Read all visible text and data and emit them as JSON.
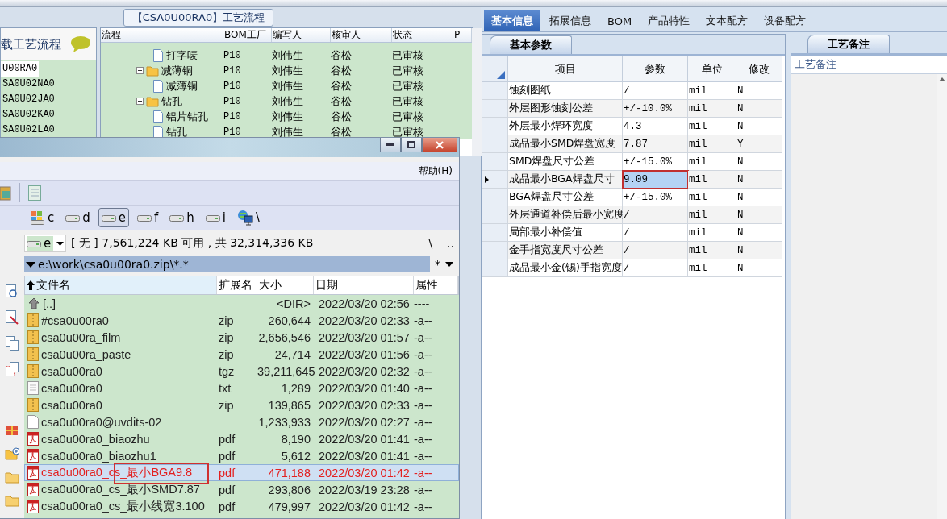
{
  "process_window": {
    "title": "【CSA0U00RA0】工艺流程",
    "side_panel": {
      "heading": "载工艺流程",
      "items": [
        {
          "label": "U00RA0",
          "selected": true
        },
        {
          "label": "SA0U02NA0",
          "selected": false
        },
        {
          "label": "SA0U02JA0",
          "selected": false
        },
        {
          "label": "SA0U02KA0",
          "selected": false
        },
        {
          "label": "SA0U02LA0",
          "selected": false
        }
      ]
    },
    "tree_table": {
      "columns": [
        "流程",
        "BOM工厂",
        "编写人",
        "核审人",
        "状态",
        "P"
      ],
      "rows": [
        {
          "name": "打字唛",
          "kind": "file",
          "bom_factory": "P10",
          "author": "刘伟生",
          "reviewer": "谷松",
          "status": "已审核"
        },
        {
          "name": "减薄铜",
          "kind": "folder",
          "expanded": true,
          "bom_factory": "P10",
          "author": "刘伟生",
          "reviewer": "谷松",
          "status": "已审核",
          "children": [
            {
              "name": "减薄铜",
              "kind": "file",
              "bom_factory": "P10",
              "author": "刘伟生",
              "reviewer": "谷松",
              "status": "已审核"
            }
          ]
        },
        {
          "name": "钻孔",
          "kind": "folder",
          "expanded": true,
          "bom_factory": "P10",
          "author": "刘伟生",
          "reviewer": "谷松",
          "status": "已审核",
          "children": [
            {
              "name": "铝片钻孔",
              "kind": "file",
              "bom_factory": "P10",
              "author": "刘伟生",
              "reviewer": "谷松",
              "status": "已审核"
            },
            {
              "name": "钻孔",
              "kind": "file",
              "bom_factory": "P10",
              "author": "刘伟生",
              "reviewer": "谷松",
              "status": "已审核"
            }
          ]
        }
      ]
    }
  },
  "file_manager": {
    "menu": [
      "帮助(H)"
    ],
    "drives": [
      {
        "label": "c",
        "kind": "system",
        "selected": false
      },
      {
        "label": "d",
        "kind": "disk",
        "selected": false
      },
      {
        "label": "e",
        "kind": "disk",
        "selected": true
      },
      {
        "label": "f",
        "kind": "disk",
        "selected": false
      },
      {
        "label": "h",
        "kind": "disk",
        "selected": false
      },
      {
        "label": "i",
        "kind": "disk",
        "selected": false
      },
      {
        "label": "\\",
        "kind": "network",
        "selected": false
      }
    ],
    "drive_combo": "e",
    "free_space": "[ 无 ]  7,561,224 KB 可用 , 共 32,314,336 KB",
    "root_button": "\\",
    "up_button": "..",
    "path": "e:\\work\\csa0u00ra0.zip\\*.*",
    "filter": "*",
    "columns": [
      {
        "label": "文件名",
        "sorted": true
      },
      {
        "label": "扩展名",
        "sorted": false
      },
      {
        "label": "大小",
        "sorted": false
      },
      {
        "label": "日期",
        "sorted": false
      },
      {
        "label": "属性",
        "sorted": false
      }
    ],
    "files": [
      {
        "name": "[..]",
        "kind": "up",
        "size": "<DIR>",
        "date": "2022/03/20 02:56",
        "attr": "----",
        "selected": false,
        "annotated": false
      },
      {
        "name": "#csa0u00ra0",
        "kind": "archive",
        "ext": "zip",
        "size": "260,644",
        "date": "2022/03/20 02:33",
        "attr": "-a--",
        "selected": false,
        "annotated": false
      },
      {
        "name": "csa0u00ra_film",
        "kind": "archive",
        "ext": "zip",
        "size": "2,656,546",
        "date": "2022/03/20 01:57",
        "attr": "-a--",
        "selected": false,
        "annotated": false
      },
      {
        "name": "csa0u00ra_paste",
        "kind": "archive",
        "ext": "zip",
        "size": "24,714",
        "date": "2022/03/20 01:56",
        "attr": "-a--",
        "selected": false,
        "annotated": false
      },
      {
        "name": "csa0u00ra0",
        "kind": "archive",
        "ext": "tgz",
        "size": "39,211,645",
        "date": "2022/03/20 02:32",
        "attr": "-a--",
        "selected": false,
        "annotated": false
      },
      {
        "name": "csa0u00ra0",
        "kind": "text",
        "ext": "txt",
        "size": "1,289",
        "date": "2022/03/20 01:40",
        "attr": "-a--",
        "selected": false,
        "annotated": false
      },
      {
        "name": "csa0u00ra0",
        "kind": "archive",
        "ext": "zip",
        "size": "139,865",
        "date": "2022/03/20 02:33",
        "attr": "-a--",
        "selected": false,
        "annotated": false
      },
      {
        "name": "csa0u00ra0@uvdits-02",
        "kind": "file",
        "size": "1,233,933",
        "date": "2022/03/20 02:27",
        "attr": "-a--",
        "selected": false,
        "annotated": false
      },
      {
        "name": "csa0u00ra0_biaozhu",
        "kind": "pdf",
        "ext": "pdf",
        "size": "8,190",
        "date": "2022/03/20 01:41",
        "attr": "-a--",
        "selected": false,
        "annotated": false
      },
      {
        "name": "csa0u00ra0_biaozhu1",
        "kind": "pdf",
        "ext": "pdf",
        "size": "5,612",
        "date": "2022/03/20 01:41",
        "attr": "-a--",
        "selected": false,
        "annotated": false
      },
      {
        "name": "csa0u00ra0_cs_最小BGA9.8",
        "kind": "pdf",
        "ext": "pdf",
        "size": "471,188",
        "date": "2022/03/20 01:42",
        "attr": "-a--",
        "selected": true,
        "annotated": true
      },
      {
        "name": "csa0u00ra0_cs_最小SMD7.87",
        "kind": "pdf",
        "ext": "pdf",
        "size": "293,806",
        "date": "2022/03/19 23:28",
        "attr": "-a--",
        "selected": false,
        "annotated": false
      },
      {
        "name": "csa0u00ra0_cs_最小线宽3.100",
        "kind": "pdf",
        "ext": "pdf",
        "size": "479,997",
        "date": "2022/03/20 01:42",
        "attr": "-a--",
        "selected": false,
        "annotated": false
      }
    ]
  },
  "tabs": [
    {
      "label": "基本信息",
      "selected": true
    },
    {
      "label": "拓展信息",
      "selected": false
    },
    {
      "label": "BOM",
      "selected": false
    },
    {
      "label": "产品特性",
      "selected": false
    },
    {
      "label": "文本配方",
      "selected": false
    },
    {
      "label": "设备配方",
      "selected": false
    }
  ],
  "params_panel": {
    "tab": "基本参数",
    "columns": [
      "项目",
      "参数",
      "单位",
      "修改"
    ],
    "rows": [
      {
        "item": "蚀刻图纸",
        "value": "/",
        "unit": "mil",
        "modified": "N",
        "current": false,
        "annotated": false
      },
      {
        "item": "外层图形蚀刻公差",
        "value": "+/-10.0%",
        "unit": "mil",
        "modified": "N",
        "current": false,
        "annotated": false
      },
      {
        "item": "外层最小焊环宽度",
        "value": "4.3",
        "unit": "mil",
        "modified": "N",
        "current": false,
        "annotated": false
      },
      {
        "item": "成品最小SMD焊盘宽度",
        "value": "7.87",
        "unit": "mil",
        "modified": "Y",
        "current": false,
        "annotated": false
      },
      {
        "item": "SMD焊盘尺寸公差",
        "value": "+/-15.0%",
        "unit": "mil",
        "modified": "N",
        "current": false,
        "annotated": false
      },
      {
        "item": "成品最小BGA焊盘尺寸",
        "value": "9.09",
        "unit": "mil",
        "modified": "N",
        "current": true,
        "annotated": true
      },
      {
        "item": "BGA焊盘尺寸公差",
        "value": "+/-15.0%",
        "unit": "mil",
        "modified": "N",
        "current": false,
        "annotated": false
      },
      {
        "item": "外层通道补偿后最小宽度",
        "value": "/",
        "unit": "mil",
        "modified": "N",
        "current": false,
        "annotated": false
      },
      {
        "item": "局部最小补偿值",
        "value": "/",
        "unit": "mil",
        "modified": "N",
        "current": false,
        "annotated": false
      },
      {
        "item": "金手指宽度尺寸公差",
        "value": "/",
        "unit": "mil",
        "modified": "N",
        "current": false,
        "annotated": false
      },
      {
        "item": "成品最小金(锡)手指宽度",
        "value": "/",
        "unit": "mil",
        "modified": "N",
        "current": false,
        "annotated": false
      }
    ]
  },
  "notes_panel": {
    "tab": "工艺备注",
    "label": "工艺备注"
  }
}
